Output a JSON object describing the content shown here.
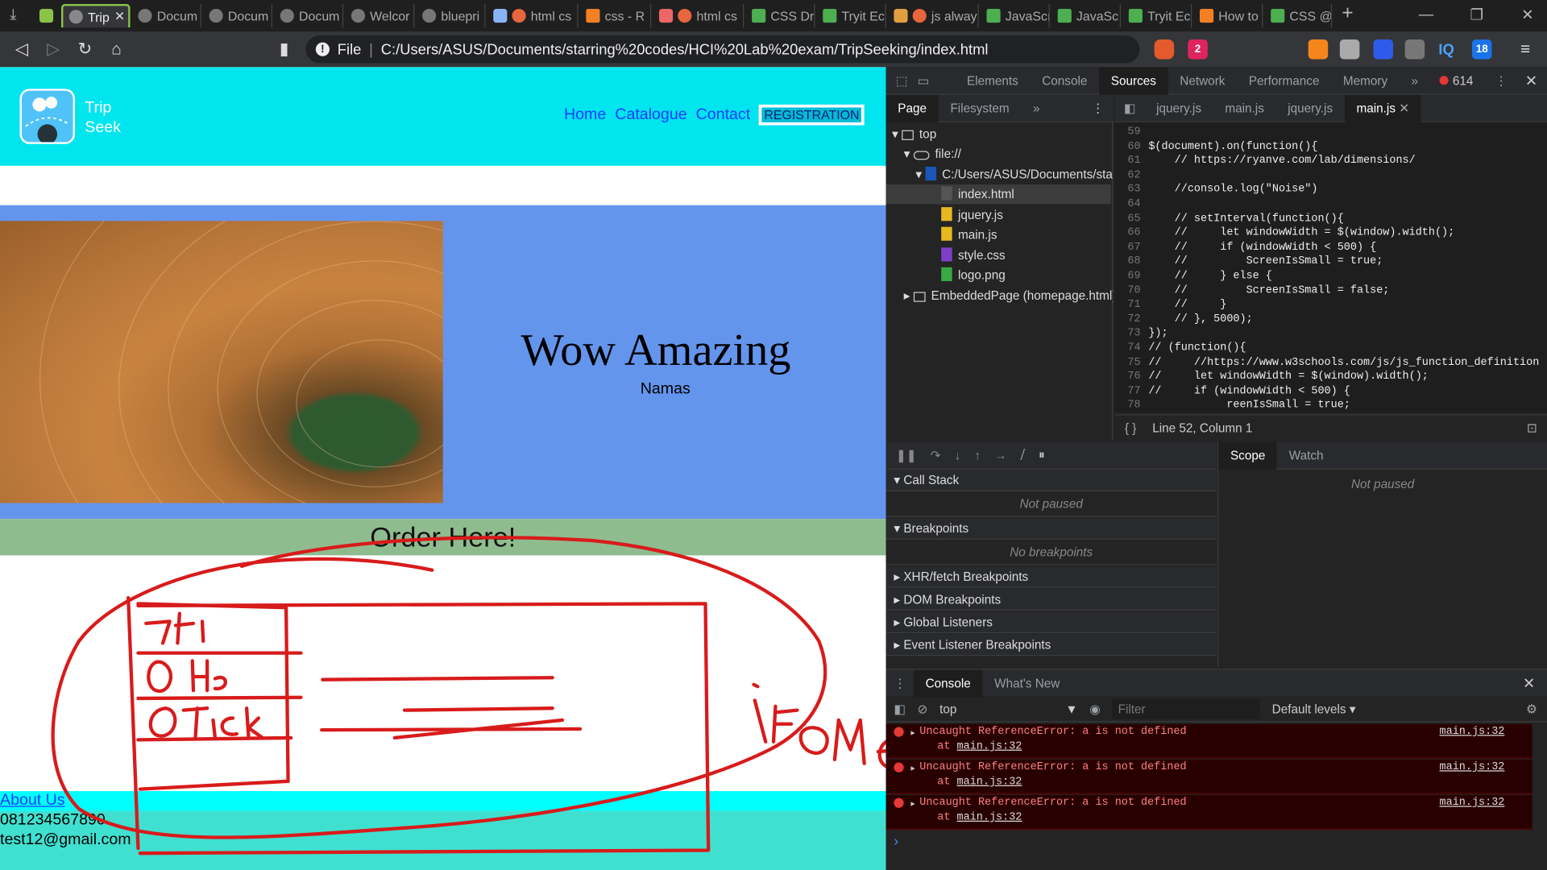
{
  "browser": {
    "tabs": [
      "Trip",
      "Docum",
      "Docum",
      "Docum",
      "Welcor",
      "bluepri",
      "html cs",
      "css - R",
      "html cs",
      "CSS Dr",
      "Tryit Ec",
      "js alway",
      "JavaScr",
      "JavaSc",
      "Tryit Ec",
      "How to",
      "CSS @"
    ],
    "tab_close": "✕",
    "new_tab": "+",
    "address": {
      "protocol_label": "File",
      "url": "C:/Users/ASUS/Documents/starring%20codes/HCI%20Lab%20exam/TripSeeking/index.html"
    },
    "extension_badges": {
      "brave_count": "2",
      "calendar_count": "18",
      "iq": "IQ"
    }
  },
  "site": {
    "logo_text_1": "Trip",
    "logo_text_2": "Seek",
    "nav": {
      "home": "Home",
      "catalogue": "Catalogue",
      "contact": "Contact",
      "registration": "REGISTRATION"
    },
    "hero_title": "Wow Amazing",
    "hero_subtitle": "Namas",
    "order_heading": "Order Here!",
    "footer": {
      "about": "About Us",
      "phone": "081234567890",
      "email": "test12@gmail.com"
    }
  },
  "devtools": {
    "tabs": [
      "Elements",
      "Console",
      "Sources",
      "Network",
      "Performance",
      "Memory"
    ],
    "more": "»",
    "error_count": "614",
    "nav_tabs": [
      "Page",
      "Filesystem"
    ],
    "file_tabs": [
      "jquery.js",
      "main.js",
      "jquery.js",
      "main.js"
    ],
    "tree": {
      "top": "top",
      "origin": "file://",
      "folder": "C:/Users/ASUS/Documents/sta",
      "files": [
        "index.html",
        "jquery.js",
        "main.js",
        "style.css",
        "logo.png"
      ],
      "embedded": "EmbeddedPage (homepage.html)"
    },
    "code_lines": [
      {
        "n": "59",
        "t": ""
      },
      {
        "n": "60",
        "t": "$(document).on(function(){"
      },
      {
        "n": "61",
        "t": "    // https://ryanve.com/lab/dimensions/"
      },
      {
        "n": "62",
        "t": ""
      },
      {
        "n": "63",
        "t": "    //console.log(\"Noise\")"
      },
      {
        "n": "64",
        "t": ""
      },
      {
        "n": "65",
        "t": "    // setInterval(function(){"
      },
      {
        "n": "66",
        "t": "    //     let windowWidth = $(window).width();"
      },
      {
        "n": "67",
        "t": "    //     if (windowWidth < 500) {"
      },
      {
        "n": "68",
        "t": "    //         ScreenIsSmall = true;"
      },
      {
        "n": "69",
        "t": "    //     } else {"
      },
      {
        "n": "70",
        "t": "    //         ScreenIsSmall = false;"
      },
      {
        "n": "71",
        "t": "    //     }"
      },
      {
        "n": "72",
        "t": "    // }, 5000);"
      },
      {
        "n": "73",
        "t": "});"
      },
      {
        "n": "74",
        "t": "// (function(){"
      },
      {
        "n": "75",
        "t": "//     //https://www.w3schools.com/js/js_function_definition"
      },
      {
        "n": "76",
        "t": "//     let windowWidth = $(window).width();"
      },
      {
        "n": "77",
        "t": "//     if (windowWidth < 500) {"
      },
      {
        "n": "78",
        "t": "            reenIsSmall = true;"
      }
    ],
    "status": "Line 52, Column 1",
    "sections": {
      "call_stack": "Call Stack",
      "not_paused": "Not paused",
      "breakpoints": "Breakpoints",
      "no_breakpoints": "No breakpoints",
      "xhr": "XHR/fetch Breakpoints",
      "dom": "DOM Breakpoints",
      "global": "Global Listeners",
      "event": "Event Listener Breakpoints"
    },
    "scope_tabs": [
      "Scope",
      "Watch"
    ],
    "scope_note": "Not paused",
    "drawer_tabs": [
      "Console",
      "What's New"
    ],
    "console": {
      "context": "top",
      "filter_placeholder": "Filter",
      "levels": "Default levels"
    },
    "errors": [
      {
        "msg": "Uncaught ReferenceError: a is not defined",
        "at": "at",
        "src": "main.js:32",
        "at_src": "main.js:32"
      },
      {
        "msg": "Uncaught ReferenceError: a is not defined",
        "at": "at",
        "src": "main.js:32",
        "at_src": "main.js:32"
      },
      {
        "msg": "Uncaught ReferenceError: a is not defined",
        "at": "at",
        "src": "main.js:32",
        "at_src": "main.js:32"
      }
    ],
    "prompt": "›"
  },
  "annotation_color": "#d81b1b"
}
